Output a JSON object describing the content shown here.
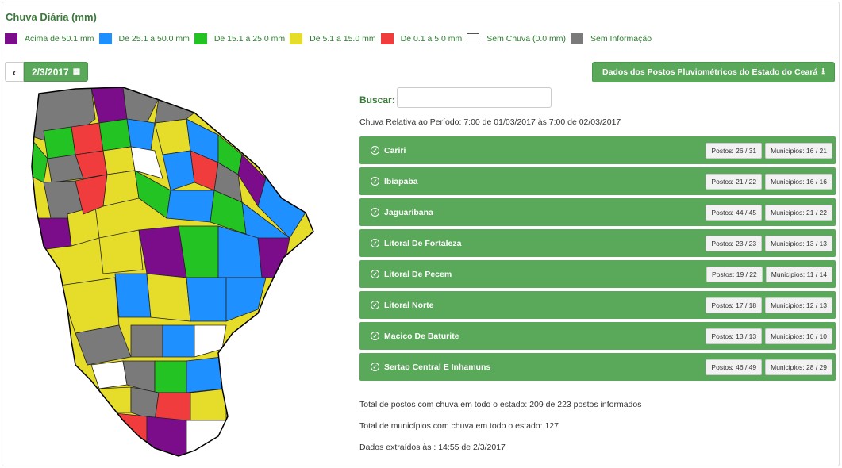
{
  "title": "Chuva Diária (mm)",
  "legend": [
    {
      "label": "Acima de 50.1 mm",
      "color": "#7b0d8b"
    },
    {
      "label": "De 25.1 a 50.0 mm",
      "color": "#1e90ff"
    },
    {
      "label": "De 15.1 a 25.0 mm",
      "color": "#22c322"
    },
    {
      "label": "De 5.1 a 15.0 mm",
      "color": "#e6dc2a"
    },
    {
      "label": "De 0.1 a 5.0 mm",
      "color": "#f03c3c"
    },
    {
      "label": "Sem Chuva (0.0 mm)",
      "color": "#ffffff"
    },
    {
      "label": "Sem Informação",
      "color": "#7a7a7a"
    }
  ],
  "date_nav": {
    "prev_icon": "chevron-left-icon",
    "date": "2/3/2017",
    "calendar_icon": "calendar-icon"
  },
  "download_label": "Dados dos Postos Pluviométricos do Estado do Ceará",
  "search": {
    "label": "Buscar:",
    "value": "",
    "placeholder": ""
  },
  "period": "Chuva Relativa ao Período: 7:00 de 01/03/2017 às 7:00 de 02/03/2017",
  "regions": [
    {
      "name": "Cariri",
      "postos": "Postos: 26 / 31",
      "municipios": "Municipios: 16 / 21"
    },
    {
      "name": "Ibiapaba",
      "postos": "Postos: 21 / 22",
      "municipios": "Municipios: 16 / 16"
    },
    {
      "name": "Jaguaribana",
      "postos": "Postos: 44 / 45",
      "municipios": "Municipios: 21 / 22"
    },
    {
      "name": "Litoral De Fortaleza",
      "postos": "Postos: 23 / 23",
      "municipios": "Municipios: 13 / 13"
    },
    {
      "name": "Litoral De Pecem",
      "postos": "Postos: 19 / 22",
      "municipios": "Municipios: 11 / 14"
    },
    {
      "name": "Litoral Norte",
      "postos": "Postos: 17 / 18",
      "municipios": "Municipios: 12 / 13"
    },
    {
      "name": "Macico De Baturite",
      "postos": "Postos: 13 / 13",
      "municipios": "Municipios: 10 / 10"
    },
    {
      "name": "Sertao Central E Inhamuns",
      "postos": "Postos: 46 / 49",
      "municipios": "Municipios: 28 / 29"
    }
  ],
  "stats": {
    "postos": "Total de postos com chuva em todo o estado: 209 de 223 postos informados",
    "municipios": "Total de municípios com chuva em todo o estado: 127",
    "extraidos": "Dados extraídos às : 14:55 de 2/3/2017"
  }
}
